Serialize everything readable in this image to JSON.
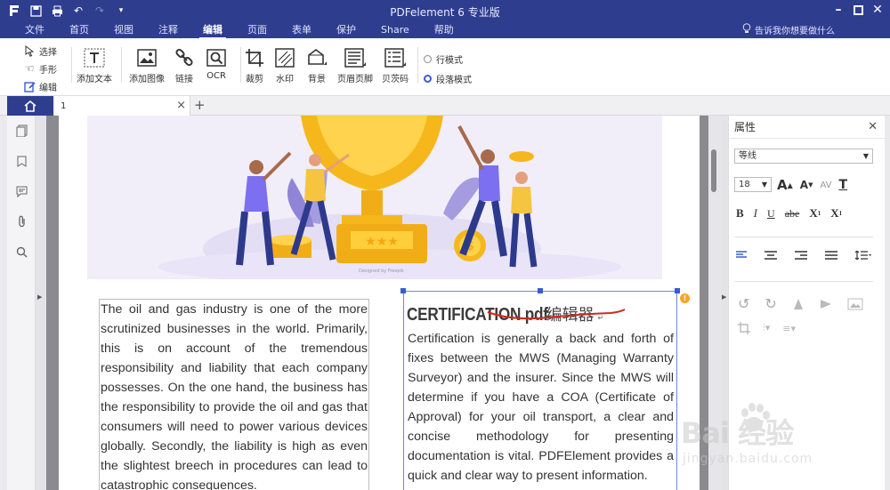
{
  "window": {
    "title": "PDFelement  6 专业版"
  },
  "menu": {
    "items": [
      {
        "label": "文件"
      },
      {
        "label": "首页"
      },
      {
        "label": "视图"
      },
      {
        "label": "注释"
      },
      {
        "label": "编辑"
      },
      {
        "label": "页面"
      },
      {
        "label": "表单"
      },
      {
        "label": "保护"
      },
      {
        "label": "Share"
      },
      {
        "label": "帮助"
      }
    ],
    "active": "编辑",
    "tell_me": "告诉我你想要做什么"
  },
  "ribbon": {
    "modes": {
      "select": "选择",
      "hand": "手形",
      "edit": "编辑"
    },
    "tools": {
      "add_text": "添加文本",
      "add_image": "添加图像",
      "link": "链接",
      "ocr": "OCR",
      "crop": "裁剪",
      "watermark": "水印",
      "background": "背景",
      "header_footer": "页眉页脚",
      "bates": "贝茨码"
    },
    "edit_modes": {
      "line": "行模式",
      "paragraph": "段落模式",
      "selected": "paragraph"
    }
  },
  "tabs": {
    "doc_tab_label": "1"
  },
  "document": {
    "image_credit": "Designed by Freepik",
    "left_paragraph": "The oil and gas industry is one of the more scrutinized businesses in the world. Primarily, this is on account of the tremendous responsibility and liability that each company possesses. On the one hand, the business has the responsibility to provide the oil and gas that consumers will need to power various devices globally. Secondly, the liability is high as even the slightest breech in procedures can lead to catastrophic consequences.",
    "right_title_en": "CERTIFICATION pdf",
    "right_title_cn": "编辑器",
    "right_paragraph": "Certification is generally a back and forth of fixes between the MWS (Managing Warranty Surveyor) and the insurer. Since the MWS will determine if you have a COA (Certificate of Approval) for your oil transport, a clear and concise methodology for presenting documentation is vital. PDFElement provides a quick and clear way to present information."
  },
  "properties": {
    "title": "属性",
    "font_family": "等线",
    "font_size": "18"
  },
  "watermark": {
    "brand": "Bai 经验",
    "url": "jingyan.baidu.com"
  },
  "colors": {
    "titlebar": "#2f3d8f",
    "accent": "#3a5ccc",
    "selection": "#6e87d8",
    "scribble": "#d0281d"
  }
}
